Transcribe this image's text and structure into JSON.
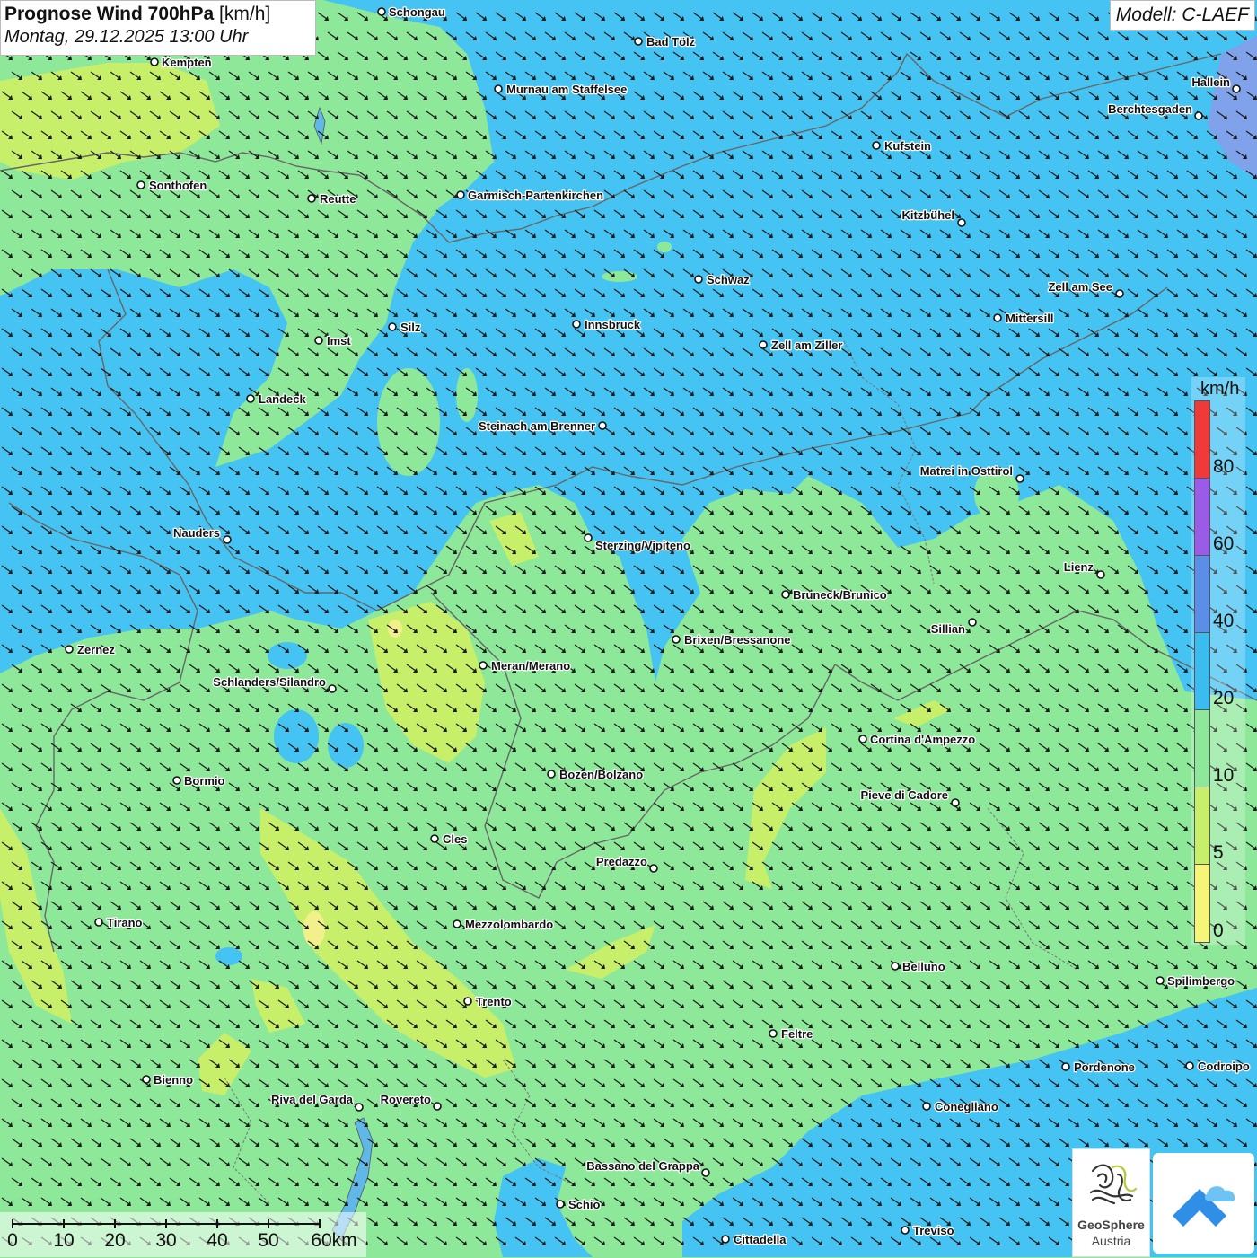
{
  "header": {
    "title": "Prognose Wind 700hPa",
    "unit": "[km/h]",
    "datetime": "Montag, 29.12.2025 13:00 Uhr",
    "model": "Modell: C-LAEF"
  },
  "legend": {
    "unit": "km/h",
    "labels": [
      "80",
      "60",
      "40",
      "20",
      "10",
      "5",
      "0"
    ],
    "colors": {
      "above_80": "#f03a3a",
      "60_80": "#9a5ce6",
      "40_60": "#5b8ee6",
      "20_40": "#3bbcf0",
      "10_20": "#8ee89a",
      "5_10": "#c8ef6a",
      "0_5": "#f5f577"
    }
  },
  "map": {
    "wind_direction": "northwest",
    "cities": [
      {
        "name": "Schongau"
      },
      {
        "name": "Bad Tölz"
      },
      {
        "name": "Kempten"
      },
      {
        "name": "Murnau am Staffelsee"
      },
      {
        "name": "Hallein"
      },
      {
        "name": "Berchtesgaden"
      },
      {
        "name": "Kufstein"
      },
      {
        "name": "Sonthofen"
      },
      {
        "name": "Reutte"
      },
      {
        "name": "Garmisch-Partenkirchen"
      },
      {
        "name": "Kitzbühel"
      },
      {
        "name": "Schwaz"
      },
      {
        "name": "Zell am See"
      },
      {
        "name": "Mittersill"
      },
      {
        "name": "Innsbruck"
      },
      {
        "name": "Silz"
      },
      {
        "name": "Imst"
      },
      {
        "name": "Zell am Ziller"
      },
      {
        "name": "Landeck"
      },
      {
        "name": "Steinach am Brenner"
      },
      {
        "name": "Matrei in Osttirol"
      },
      {
        "name": "Nauders"
      },
      {
        "name": "Sterzing/Vipiteno"
      },
      {
        "name": "Lienz"
      },
      {
        "name": "Bruneck/Brunico"
      },
      {
        "name": "Sillian"
      },
      {
        "name": "Zernez"
      },
      {
        "name": "Brixen/Bressanone"
      },
      {
        "name": "Meran/Merano"
      },
      {
        "name": "Schlanders/Silandro"
      },
      {
        "name": "Cortina d'Ampezzo"
      },
      {
        "name": "Bozen/Bolzano"
      },
      {
        "name": "Bormio"
      },
      {
        "name": "Pieve di Cadore"
      },
      {
        "name": "Cles"
      },
      {
        "name": "Predazzo"
      },
      {
        "name": "Tirano"
      },
      {
        "name": "Mezzolombardo"
      },
      {
        "name": "Belluno"
      },
      {
        "name": "Spilimbergo"
      },
      {
        "name": "Trento"
      },
      {
        "name": "Feltre"
      },
      {
        "name": "Bienno"
      },
      {
        "name": "Pordenone"
      },
      {
        "name": "Codroipo"
      },
      {
        "name": "Riva del Garda"
      },
      {
        "name": "Rovereto"
      },
      {
        "name": "Conegliano"
      },
      {
        "name": "Bassano del Grappa"
      },
      {
        "name": "Schio"
      },
      {
        "name": "Treviso"
      },
      {
        "name": "Cittadella"
      }
    ]
  },
  "scalebar": {
    "labels": [
      "0",
      "10",
      "20",
      "30",
      "40",
      "50",
      "60km"
    ]
  },
  "logos": {
    "geosphere_name": "GeoSphere",
    "geosphere_sub": "Austria"
  }
}
